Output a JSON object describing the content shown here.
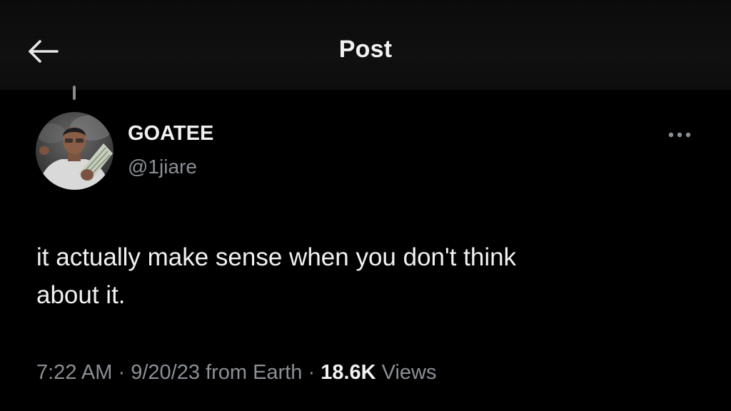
{
  "header": {
    "title": "Post",
    "back_icon": "arrow-left-icon"
  },
  "post": {
    "author": {
      "display_name": "GOATEE",
      "handle": "@1jiare"
    },
    "more_icon": "more-horizontal-icon",
    "text_line1": "it actually make sense when you don't think",
    "text_line2": "about it.",
    "meta": {
      "time": "7:22 AM",
      "date": "9/20/23",
      "source": "from Earth",
      "separator": "·",
      "views_count": "18.6K",
      "views_label": "Views"
    }
  },
  "colors": {
    "background": "#000000",
    "header_background": "#0e0e0e",
    "primary_text": "#e7e9ea",
    "secondary_text": "#8b9096"
  }
}
